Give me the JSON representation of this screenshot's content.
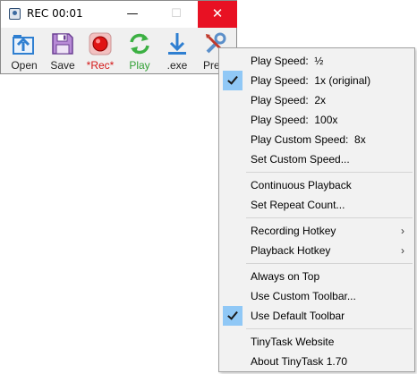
{
  "window": {
    "title": "REC 00:01",
    "controls": {
      "minimize": "—",
      "maximize": "☐",
      "close": "✕"
    }
  },
  "toolbar": {
    "open_label": "Open",
    "save_label": "Save",
    "rec_label": "*Rec*",
    "play_label": "Play",
    "exe_label": ".exe",
    "prefs_label": "Prefs"
  },
  "menu": {
    "items": [
      {
        "label": "Play Speed:  ½",
        "checked": false
      },
      {
        "label": "Play Speed:  1x (original)",
        "checked": true
      },
      {
        "label": "Play Speed:  2x",
        "checked": false
      },
      {
        "label": "Play Speed:  100x",
        "checked": false
      },
      {
        "label": "Play Custom Speed:  8x",
        "checked": false
      },
      {
        "label": "Set Custom Speed...",
        "checked": false
      },
      {
        "label": "Continuous Playback",
        "checked": false
      },
      {
        "label": "Set Repeat Count...",
        "checked": false
      },
      {
        "label": "Recording Hotkey",
        "submenu": true
      },
      {
        "label": "Playback Hotkey",
        "submenu": true
      },
      {
        "label": "Always on Top",
        "checked": false
      },
      {
        "label": "Use Custom Toolbar...",
        "checked": false
      },
      {
        "label": "Use Default Toolbar",
        "checked": true
      },
      {
        "label": "TinyTask Website",
        "checked": false
      },
      {
        "label": "About TinyTask 1.70",
        "checked": false
      }
    ],
    "submenu_arrow": "›"
  },
  "colors": {
    "close_button": "#e81123",
    "check_highlight": "#90c8f6",
    "rec_label": "#d41717",
    "play_label": "#32a035",
    "icon_blue": "#2f7fd1"
  }
}
